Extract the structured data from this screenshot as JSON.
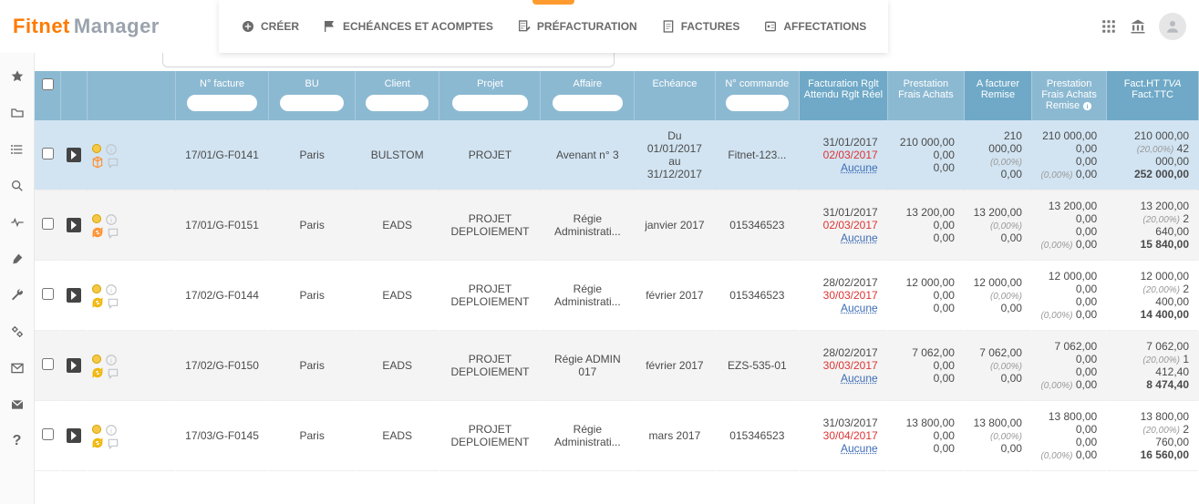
{
  "logo": {
    "part1": "Fitnet",
    "part2": "Manager"
  },
  "toolbar": {
    "create": "CRÉER",
    "echeances": "ECHÉANCES ET ACOMPTES",
    "prefact": "PRÉFACTURATION",
    "factures": "FACTURES",
    "affect": "AFFECTATIONS"
  },
  "headers": {
    "num": "N° facture",
    "bu": "BU",
    "client": "Client",
    "projet": "Projet",
    "affaire": "Affaire",
    "echeance": "Echéance",
    "commande": "N° commande",
    "fact_l1": "Facturation",
    "fact_l2": "Rglt Attendu",
    "fact_l3": "Rglt Réel",
    "presta_l1": "Prestation",
    "presta_l2": "Frais",
    "presta_l3": "Achats",
    "afact_l1": "A facturer",
    "afact_l2": "Remise",
    "pfa_l1": "Prestation",
    "pfa_l2": "Frais",
    "pfa_l3": "Achats",
    "pfa_l4": "Remise",
    "httc_l1": "Fact.HT",
    "httc_l2": "TVA",
    "httc_l3": "Fact.TTC"
  },
  "rows": [
    {
      "selected": true,
      "iconset": "cube",
      "num": "17/01/G-F0141",
      "bu": "Paris",
      "client": "BULSTOM",
      "projet": "PROJET",
      "affaire": "Avenant n° 3",
      "ech_l1": "Du",
      "ech_l2": "01/01/2017",
      "ech_l3": "au",
      "ech_l4": "31/12/2017",
      "cmd": "Fitnet-123...",
      "fact_l1": "31/01/2017",
      "fact_l2": "02/03/2017",
      "fact_l3": "Aucune",
      "presta_l1": "210 000,00",
      "presta_l2": "0,00",
      "presta_l3": "0,00",
      "afact_l1": "210 000,00",
      "afact_pct": "(0,00%)",
      "afact_l2": "0,00",
      "pfa_l1": "210 000,00",
      "pfa_l2": "0,00",
      "pfa_l3": "0,00",
      "pfa_pct": "(0,00%)",
      "pfa_l4": "0,00",
      "ht": "210 000,00",
      "tva_pct": "(20,00%)",
      "tva": "42 000,00",
      "ttc": "252 000,00"
    },
    {
      "selected": false,
      "iconset": "cycle-org",
      "alt": true,
      "num": "17/01/G-F0151",
      "bu": "Paris",
      "client": "EADS",
      "projet_l1": "PROJET",
      "projet_l2": "DEPLOIEMENT",
      "affaire_l1": "Régie",
      "affaire_l2": "Administrati...",
      "ech": "janvier 2017",
      "cmd": "015346523",
      "fact_l1": "31/01/2017",
      "fact_l2": "02/03/2017",
      "fact_l3": "Aucune",
      "presta_l1": "13 200,00",
      "presta_l2": "0,00",
      "presta_l3": "0,00",
      "afact_l1": "13 200,00",
      "afact_pct": "(0,00%)",
      "afact_l2": "0,00",
      "pfa_l1": "13 200,00",
      "pfa_l2": "0,00",
      "pfa_l3": "0,00",
      "pfa_pct": "(0,00%)",
      "pfa_l4": "0,00",
      "ht": "13 200,00",
      "tva_pct": "(20,00%)",
      "tva": "2 640,00",
      "ttc": "15 840,00"
    },
    {
      "selected": false,
      "iconset": "cycle-ylw",
      "num": "17/02/G-F0144",
      "bu": "Paris",
      "client": "EADS",
      "projet_l1": "PROJET",
      "projet_l2": "DEPLOIEMENT",
      "affaire_l1": "Régie",
      "affaire_l2": "Administrati...",
      "ech": "février 2017",
      "cmd": "015346523",
      "fact_l1": "28/02/2017",
      "fact_l2": "30/03/2017",
      "fact_l3": "Aucune",
      "presta_l1": "12 000,00",
      "presta_l2": "0,00",
      "presta_l3": "0,00",
      "afact_l1": "12 000,00",
      "afact_pct": "(0,00%)",
      "afact_l2": "0,00",
      "pfa_l1": "12 000,00",
      "pfa_l2": "0,00",
      "pfa_l3": "0,00",
      "pfa_pct": "(0,00%)",
      "pfa_l4": "0,00",
      "ht": "12 000,00",
      "tva_pct": "(20,00%)",
      "tva": "2 400,00",
      "ttc": "14 400,00"
    },
    {
      "selected": false,
      "iconset": "cycle-ylw",
      "alt": true,
      "num": "17/02/G-F0150",
      "bu": "Paris",
      "client": "EADS",
      "projet_l1": "PROJET",
      "projet_l2": "DEPLOIEMENT",
      "affaire": "Régie ADMIN 017",
      "ech": "février 2017",
      "cmd": "EZS-535-01",
      "fact_l1": "28/02/2017",
      "fact_l2": "30/03/2017",
      "fact_l3": "Aucune",
      "presta_l1": "7 062,00",
      "presta_l2": "0,00",
      "presta_l3": "0,00",
      "afact_l1": "7 062,00",
      "afact_pct": "(0,00%)",
      "afact_l2": "0,00",
      "pfa_l1": "7 062,00",
      "pfa_l2": "0,00",
      "pfa_l3": "0,00",
      "pfa_pct": "(0,00%)",
      "pfa_l4": "0,00",
      "ht": "7 062,00",
      "tva_pct": "(20,00%)",
      "tva": "1 412,40",
      "ttc": "8 474,40"
    },
    {
      "selected": false,
      "iconset": "cycle-ylw",
      "num": "17/03/G-F0145",
      "bu": "Paris",
      "client": "EADS",
      "projet_l1": "PROJET",
      "projet_l2": "DEPLOIEMENT",
      "affaire_l1": "Régie",
      "affaire_l2": "Administrati...",
      "ech": "mars 2017",
      "cmd": "015346523",
      "fact_l1": "31/03/2017",
      "fact_l2": "30/04/2017",
      "fact_l3": "Aucune",
      "presta_l1": "13 800,00",
      "presta_l2": "0,00",
      "presta_l3": "0,00",
      "afact_l1": "13 800,00",
      "afact_pct": "(0,00%)",
      "afact_l2": "0,00",
      "pfa_l1": "13 800,00",
      "pfa_l2": "0,00",
      "pfa_l3": "0,00",
      "pfa_pct": "(0,00%)",
      "pfa_l4": "0,00",
      "ht": "13 800,00",
      "tva_pct": "(20,00%)",
      "tva": "2 760,00",
      "ttc": "16 560,00"
    }
  ]
}
